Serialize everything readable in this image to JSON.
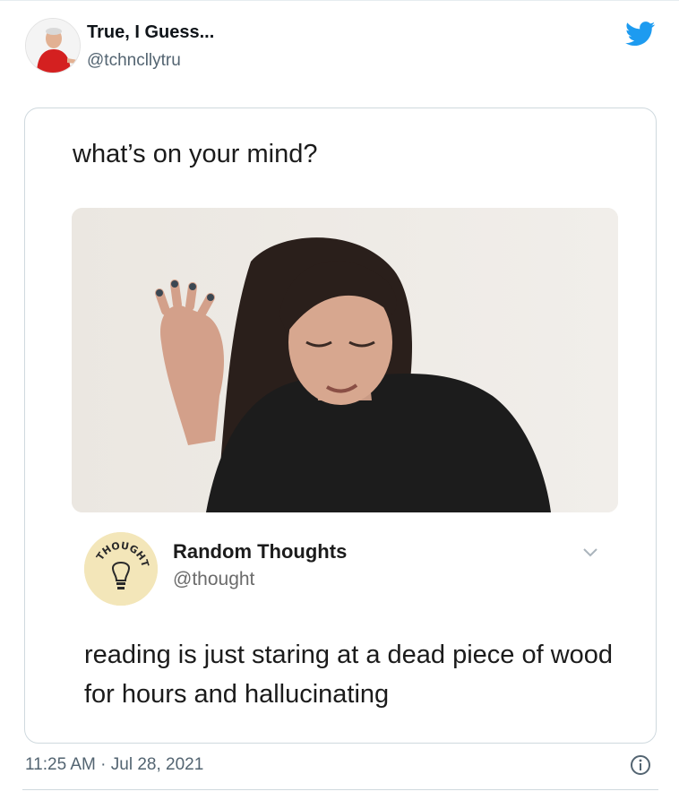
{
  "author": {
    "display_name": "True, I Guess...",
    "handle": "@tchncllytru"
  },
  "quoted_screenshot": {
    "prompt_text": "what’s on your mind?",
    "post_author_name": "Random Thoughts",
    "post_author_handle": "@thought",
    "post_text": "reading is just staring at a dead piece of wood for hours and hallucinating",
    "logo_text": "THOUGHT"
  },
  "footer": {
    "timestamp": "11:25 AM · Jul 28, 2021"
  },
  "icons": {
    "brand": "twitter-bird-icon",
    "info": "info-icon",
    "more": "chevron-down-icon"
  },
  "colors": {
    "twitter_blue": "#1d9bf0",
    "secondary_text": "#536471",
    "border": "#cfd9de"
  }
}
